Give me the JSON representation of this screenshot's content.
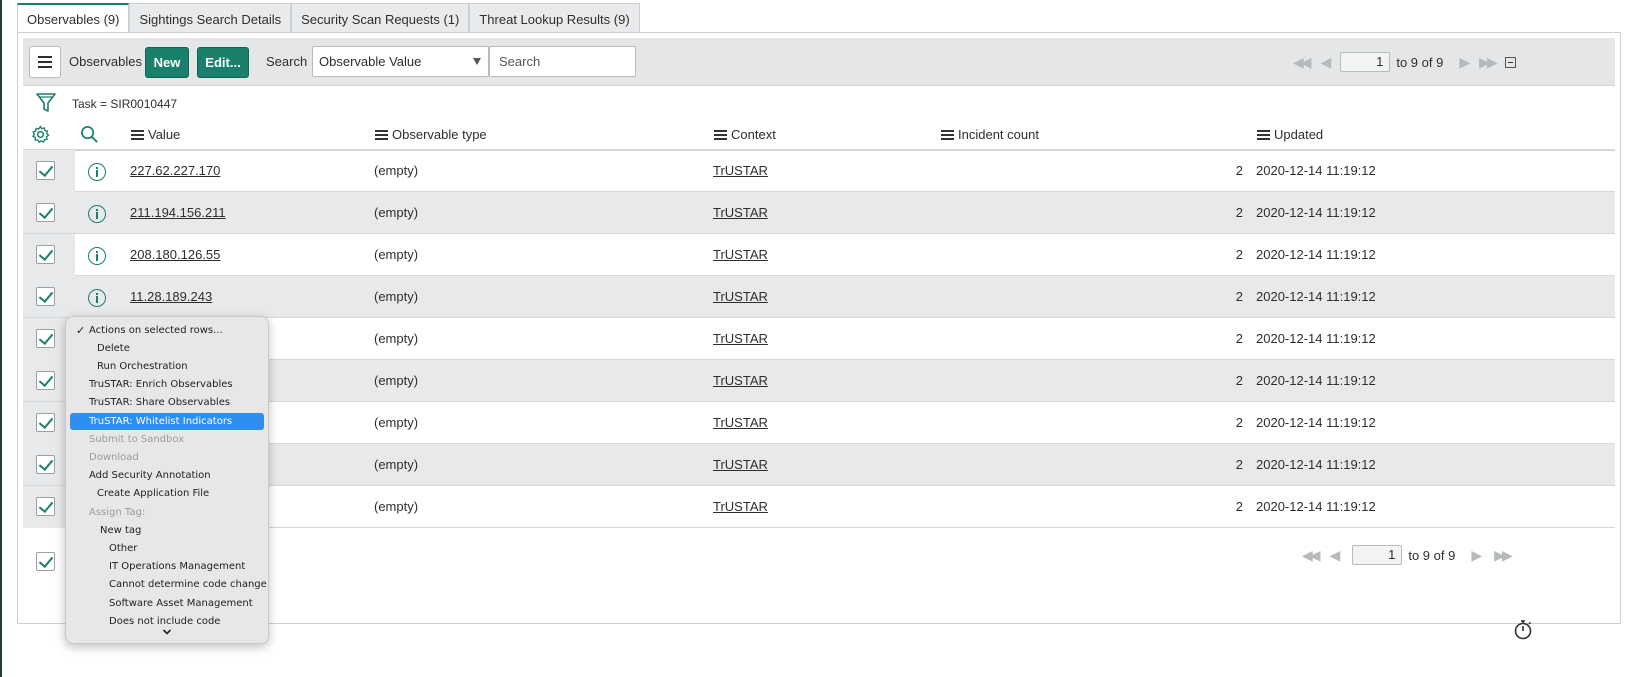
{
  "tabs": [
    {
      "label": "Observables (9)",
      "active": true
    },
    {
      "label": "Sightings Search Details",
      "active": false
    },
    {
      "label": "Security Scan Requests (1)",
      "active": false
    },
    {
      "label": "Threat Lookup Results (9)",
      "active": false
    }
  ],
  "toolbar": {
    "list_label": "Observables",
    "new_label": "New",
    "edit_label": "Edit...",
    "search_label": "Search",
    "search_field_selected": "Observable Value",
    "search_placeholder": "Search",
    "page_number": "1",
    "range_text": "to 9 of 9"
  },
  "filter": {
    "text": "Task = SIR0010447"
  },
  "columns": {
    "value": "Value",
    "observable_type": "Observable type",
    "context": "Context",
    "incident_count": "Incident count",
    "updated": "Updated"
  },
  "rows": [
    {
      "value": "227.62.227.170",
      "type": "(empty)",
      "context": "TrUSTAR",
      "count": "2",
      "updated": "2020-12-14 11:19:12"
    },
    {
      "value": "211.194.156.211",
      "type": "(empty)",
      "context": "TrUSTAR",
      "count": "2",
      "updated": "2020-12-14 11:19:12"
    },
    {
      "value": "208.180.126.55",
      "type": "(empty)",
      "context": "TrUSTAR",
      "count": "2",
      "updated": "2020-12-14 11:19:12"
    },
    {
      "value": "11.28.189.243",
      "type": "(empty)",
      "context": "TrUSTAR",
      "count": "2",
      "updated": "2020-12-14 11:19:12"
    },
    {
      "value": "",
      "type": "(empty)",
      "context": "TrUSTAR",
      "count": "2",
      "updated": "2020-12-14 11:19:12"
    },
    {
      "value": "",
      "type": "(empty)",
      "context": "TrUSTAR",
      "count": "2",
      "updated": "2020-12-14 11:19:12"
    },
    {
      "value": "",
      "type": "(empty)",
      "context": "TrUSTAR",
      "count": "2",
      "updated": "2020-12-14 11:19:12"
    },
    {
      "value": "",
      "type": "(empty)",
      "context": "TrUSTAR",
      "count": "2",
      "updated": "2020-12-14 11:19:12"
    },
    {
      "value": "",
      "type": "(empty)",
      "context": "TrUSTAR",
      "count": "2",
      "updated": "2020-12-14 11:19:12"
    }
  ],
  "footer": {
    "page_number": "1",
    "range_text": "to 9 of 9"
  },
  "menu": {
    "items": [
      {
        "label": "Actions on selected rows...",
        "checked": true,
        "indent": 0,
        "disabled": false,
        "selected": false
      },
      {
        "label": "Delete",
        "indent": 1,
        "disabled": false,
        "selected": false
      },
      {
        "label": "Run Orchestration",
        "indent": 1,
        "disabled": false,
        "selected": false
      },
      {
        "label": "TruSTAR: Enrich Observables",
        "indent": 0,
        "disabled": false,
        "selected": false
      },
      {
        "label": "TruSTAR: Share Observables",
        "indent": 0,
        "disabled": false,
        "selected": false
      },
      {
        "label": "TruSTAR: Whitelist Indicators",
        "indent": 0,
        "disabled": false,
        "selected": true
      },
      {
        "label": "Submit to Sandbox",
        "indent": 0,
        "disabled": true,
        "selected": false
      },
      {
        "label": "Download",
        "indent": 0,
        "disabled": true,
        "selected": false
      },
      {
        "label": "Add Security Annotation",
        "indent": 0,
        "disabled": false,
        "selected": false
      },
      {
        "label": "Create Application File",
        "indent": 1,
        "disabled": false,
        "selected": false
      },
      {
        "label": "Assign Tag:",
        "indent": 0,
        "disabled": true,
        "selected": false
      },
      {
        "label": "New tag",
        "indent": 2,
        "disabled": false,
        "selected": false
      },
      {
        "label": "Other",
        "indent": 3,
        "disabled": false,
        "selected": false
      },
      {
        "label": "IT Operations Management",
        "indent": 3,
        "disabled": false,
        "selected": false
      },
      {
        "label": "Cannot determine code change",
        "indent": 3,
        "disabled": false,
        "selected": false
      },
      {
        "label": "Software Asset Management",
        "indent": 3,
        "disabled": false,
        "selected": false
      },
      {
        "label": "Does not include code",
        "indent": 3,
        "disabled": false,
        "selected": false
      }
    ]
  },
  "colors": {
    "accent": "#1a7f6b",
    "selection": "#2f8fef"
  }
}
